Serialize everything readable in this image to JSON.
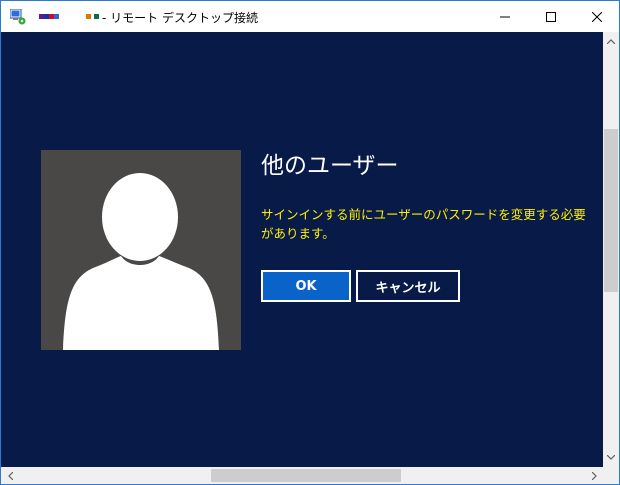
{
  "window": {
    "title": "- リモート デスクトップ接続",
    "minimize_glyph": "minimize-icon",
    "maximize_glyph": "maximize-icon",
    "close_glyph": "close-icon"
  },
  "dialog": {
    "heading": "他のユーザー",
    "message": "サインインする前にユーザーのパスワードを変更する必要があります。",
    "ok_label": "OK",
    "cancel_label": "キャンセル"
  },
  "colors": {
    "background": "#071a48",
    "message_text": "#ffef00",
    "ok_button": "#0a63c9",
    "avatar_bg": "#4a4847"
  }
}
